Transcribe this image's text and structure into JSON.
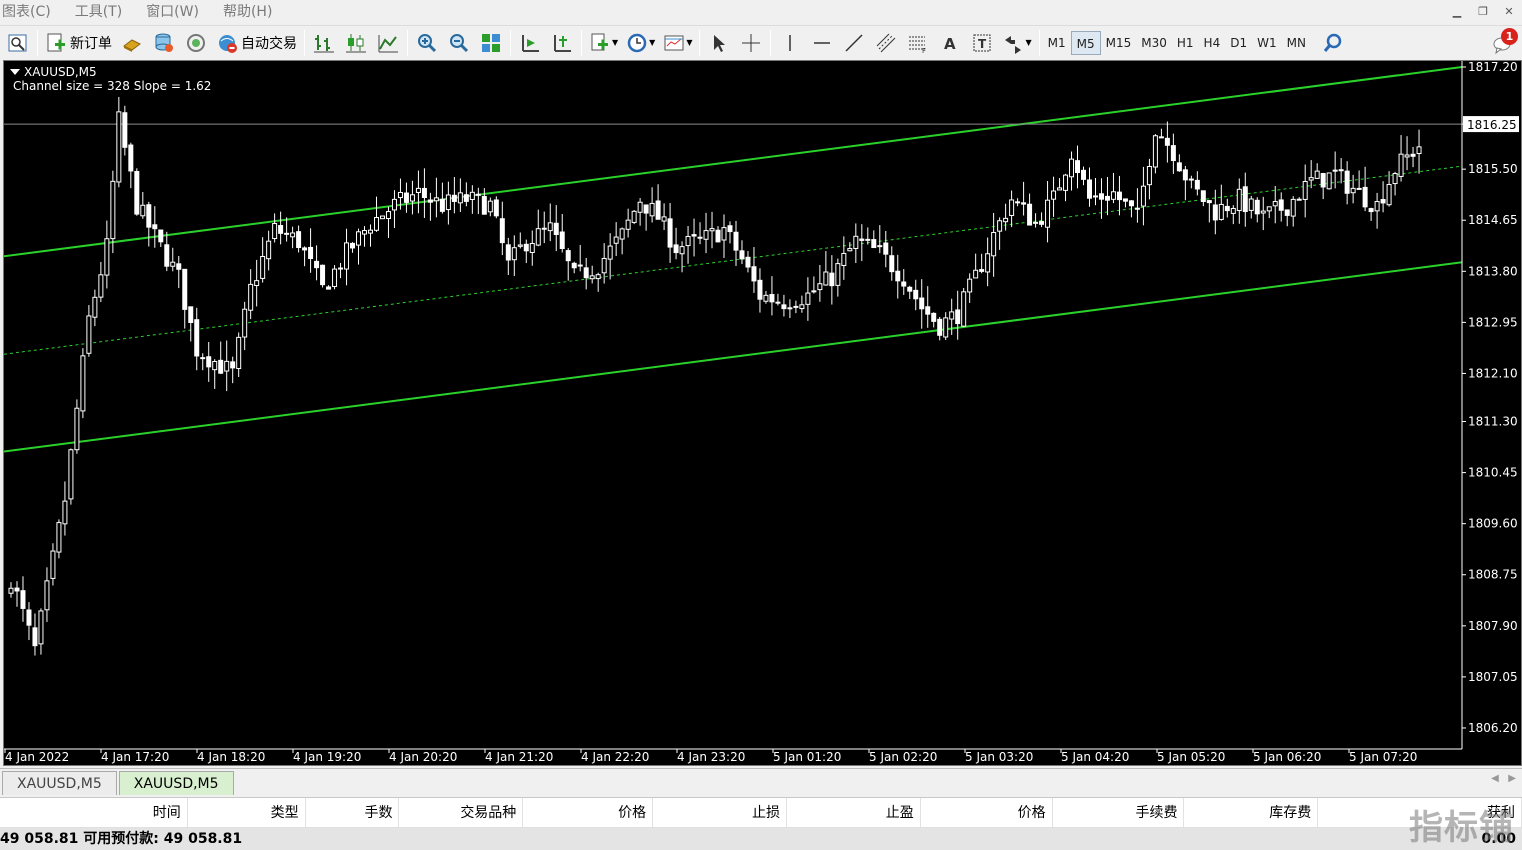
{
  "menu": [
    "图表(C)",
    "工具(T)",
    "窗口(W)",
    "帮助(H)"
  ],
  "toolbar": {
    "new_order_label": "新订单",
    "auto_trade_label": "自动交易",
    "timeframes": [
      "M1",
      "M5",
      "M15",
      "M30",
      "H1",
      "H4",
      "D1",
      "W1",
      "MN"
    ],
    "active_timeframe": "M5",
    "alert_count": "1"
  },
  "chart": {
    "symbol_label": "XAUUSD,M5",
    "indicator_label": "Channel size = 328 Slope = 1.62",
    "current_price_label": "1816.25",
    "colors": {
      "background": "#000000",
      "candle": "#ffffff",
      "channel": "#2bd12b",
      "grid_axis": "#ffffff"
    }
  },
  "chart_data": {
    "type": "candlestick",
    "symbol": "XAUUSD",
    "timeframe": "M5",
    "y_ticks": [
      "1817.20",
      "1816.25",
      "1815.50",
      "1814.65",
      "1813.80",
      "1812.95",
      "1812.10",
      "1811.30",
      "1810.45",
      "1809.60",
      "1808.75",
      "1807.90",
      "1807.05",
      "1806.20"
    ],
    "x_ticks": [
      "4 Jan 2022",
      "4 Jan 17:20",
      "4 Jan 18:20",
      "4 Jan 19:20",
      "4 Jan 20:20",
      "4 Jan 21:20",
      "4 Jan 22:20",
      "4 Jan 23:20",
      "5 Jan 01:20",
      "5 Jan 02:20",
      "5 Jan 03:20",
      "5 Jan 04:20",
      "5 Jan 05:20",
      "5 Jan 06:20",
      "5 Jan 07:20"
    ],
    "ylim": [
      1805.85,
      1817.3
    ],
    "current_price": 1816.25,
    "channel": {
      "upper": [
        1814.05,
        1817.2
      ],
      "middle": [
        1812.42,
        1815.55
      ],
      "lower": [
        1810.8,
        1813.95
      ]
    },
    "close_path": [
      [
        0,
        1808.7
      ],
      [
        4,
        1807.5
      ],
      [
        9,
        1810.0
      ],
      [
        13,
        1813.0
      ],
      [
        16,
        1814.2
      ],
      [
        18,
        1816.3
      ],
      [
        21,
        1814.9
      ],
      [
        25,
        1814.2
      ],
      [
        28,
        1813.7
      ],
      [
        31,
        1812.5
      ],
      [
        34,
        1812.3
      ],
      [
        37,
        1812.1
      ],
      [
        40,
        1813.5
      ],
      [
        44,
        1814.5
      ],
      [
        48,
        1814.3
      ],
      [
        52,
        1813.5
      ],
      [
        56,
        1814.1
      ],
      [
        60,
        1814.6
      ],
      [
        64,
        1814.9
      ],
      [
        68,
        1815.1
      ],
      [
        72,
        1814.9
      ],
      [
        76,
        1815.0
      ],
      [
        80,
        1814.9
      ],
      [
        83,
        1813.9
      ],
      [
        86,
        1814.3
      ],
      [
        90,
        1814.5
      ],
      [
        94,
        1813.7
      ],
      [
        98,
        1813.9
      ],
      [
        102,
        1814.4
      ],
      [
        105,
        1815.0
      ],
      [
        108,
        1814.7
      ],
      [
        111,
        1814.2
      ],
      [
        115,
        1814.3
      ],
      [
        119,
        1814.5
      ],
      [
        122,
        1814.0
      ],
      [
        125,
        1813.4
      ],
      [
        129,
        1813.3
      ],
      [
        133,
        1813.4
      ],
      [
        137,
        1813.7
      ],
      [
        141,
        1814.3
      ],
      [
        145,
        1814.1
      ],
      [
        149,
        1813.7
      ],
      [
        152,
        1813.2
      ],
      [
        155,
        1812.9
      ],
      [
        158,
        1813.1
      ],
      [
        161,
        1813.7
      ],
      [
        164,
        1814.4
      ],
      [
        167,
        1815.0
      ],
      [
        171,
        1814.6
      ],
      [
        174,
        1815.0
      ],
      [
        177,
        1815.8
      ],
      [
        180,
        1815.0
      ],
      [
        184,
        1815.1
      ],
      [
        188,
        1814.7
      ],
      [
        191,
        1816.2
      ],
      [
        194,
        1815.8
      ],
      [
        197,
        1815.2
      ],
      [
        201,
        1814.8
      ],
      [
        205,
        1815.0
      ],
      [
        209,
        1814.7
      ],
      [
        213,
        1814.9
      ],
      [
        217,
        1815.3
      ],
      [
        221,
        1815.4
      ],
      [
        225,
        1815.1
      ],
      [
        228,
        1814.9
      ],
      [
        231,
        1815.5
      ],
      [
        235,
        1815.9
      ]
    ]
  },
  "tabs": [
    "XAUUSD,M5",
    "XAUUSD,M5"
  ],
  "active_tab": 1,
  "terminal": {
    "columns": [
      "时间",
      "类型",
      "手数",
      "交易品种",
      "价格",
      "止损",
      "止盈",
      "价格",
      "手续费",
      "库存费",
      "获利"
    ],
    "balance_text": "49 058.81  可用预付款: 49 058.81",
    "profit": "0.00"
  },
  "watermark": "指标铺"
}
